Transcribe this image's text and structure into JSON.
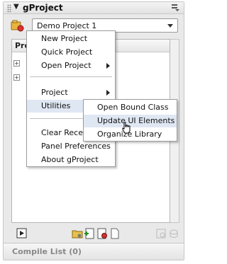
{
  "panel": {
    "title": "gProject",
    "project_select": {
      "value": "Demo Project 1"
    },
    "tree_header": "Pro",
    "compile_list": "Compile List (0)"
  },
  "context_menu": {
    "items": [
      {
        "label": "New Project"
      },
      {
        "label": "Quick Project"
      },
      {
        "label": "Open Project"
      },
      {
        "label": "Project"
      },
      {
        "label": "Utilities"
      },
      {
        "label": "Clear Recen"
      },
      {
        "label": "Panel Preferences"
      },
      {
        "label": "About gProject"
      }
    ]
  },
  "utilities_submenu": {
    "items": [
      {
        "label": "Open Bound Class"
      },
      {
        "label": "Update UI Elements"
      },
      {
        "label": "Organize Library"
      }
    ]
  },
  "icons": {
    "grip": "gripper-icon",
    "collapse": "triangle-down-icon",
    "panel_menu": "panel-options-icon",
    "project": "project-icon",
    "toolbar": [
      "play-icon",
      "folder-icon",
      "add-file-icon",
      "settings-icon",
      "blank-file-icon",
      "disabled-icon",
      "disabled-icon"
    ]
  },
  "colors": {
    "highlight": "#dfe7f3",
    "panel_bg": "#e9e9e9",
    "disabled_text": "#888888"
  }
}
